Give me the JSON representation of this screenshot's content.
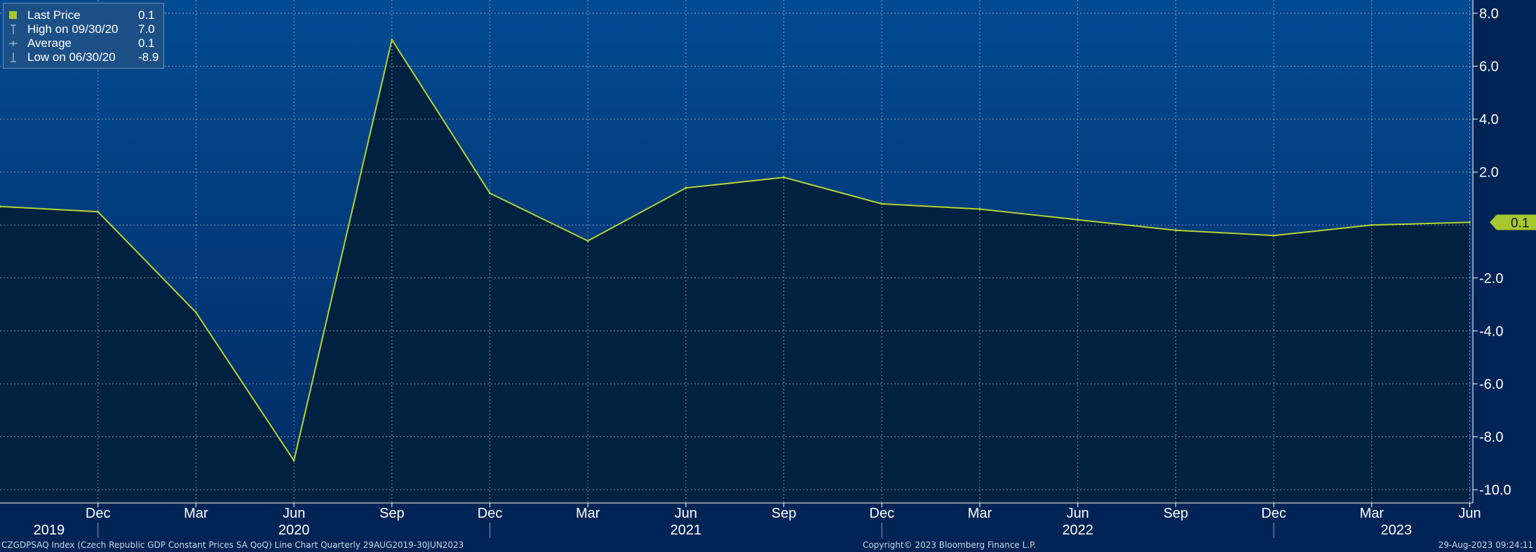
{
  "chart_data": {
    "type": "area",
    "x": [
      "09/30/19",
      "12/31/19",
      "03/31/20",
      "06/30/20",
      "09/30/20",
      "12/31/20",
      "03/31/21",
      "06/30/21",
      "09/30/21",
      "12/31/21",
      "03/31/22",
      "06/30/22",
      "09/30/22",
      "12/31/22",
      "03/31/23",
      "06/30/23"
    ],
    "series": [
      {
        "name": "Last Price",
        "values": [
          0.7,
          0.5,
          -3.3,
          -8.9,
          7.0,
          1.2,
          -0.6,
          1.4,
          1.8,
          0.8,
          0.6,
          0.2,
          -0.2,
          -0.4,
          0.0,
          0.1
        ]
      }
    ],
    "ylim": [
      -10.5,
      8.5
    ],
    "yticks": [
      {
        "v": 8,
        "label": "8.0"
      },
      {
        "v": 6,
        "label": "6.0"
      },
      {
        "v": 4,
        "label": "4.0"
      },
      {
        "v": 2,
        "label": "2.0"
      },
      {
        "v": -2,
        "label": "-2.0"
      },
      {
        "v": -4,
        "label": "-4.0"
      },
      {
        "v": -6,
        "label": "-6.0"
      },
      {
        "v": -8,
        "label": "-8.0"
      },
      {
        "v": -10,
        "label": "-10.0"
      }
    ],
    "xtick_labels": [
      "Dec",
      "Mar",
      "Jun",
      "Sep",
      "Dec",
      "Mar",
      "Jun",
      "Sep",
      "Dec",
      "Mar",
      "Jun",
      "Sep",
      "Dec",
      "Mar",
      "Jun"
    ],
    "year_labels": [
      {
        "label": "2019",
        "at": 0.5
      },
      {
        "label": "2020",
        "at": 3
      },
      {
        "label": "2021",
        "at": 7
      },
      {
        "label": "2022",
        "at": 11
      },
      {
        "label": "2023",
        "at": 14.25
      }
    ],
    "year_separators": [
      1,
      5,
      9,
      13
    ],
    "last_value_label": "0.1",
    "grid": true,
    "colors": {
      "line": "#b5d334",
      "fill": "#00213f",
      "plot_top": "#024a92",
      "plot_bottom": "#012b63",
      "badge": "#a6c730"
    }
  },
  "legend": {
    "items": [
      {
        "label": "Last Price",
        "value": "0.1",
        "marker": "square"
      },
      {
        "label": "High on 09/30/20",
        "value": "7.0",
        "marker": "high"
      },
      {
        "label": "Average",
        "value": "0.1",
        "marker": "average"
      },
      {
        "label": "Low on 06/30/20",
        "value": "-8.9",
        "marker": "low"
      }
    ]
  },
  "footer": {
    "left": "CZGDPSAQ Index (Czech Republic GDP Constant Prices SA QoQ) Line Chart  Quarterly 29AUG2019-30JUN2023",
    "center": "Copyright© 2023 Bloomberg Finance L.P.",
    "right": "29-Aug-2023 09:24:11"
  }
}
